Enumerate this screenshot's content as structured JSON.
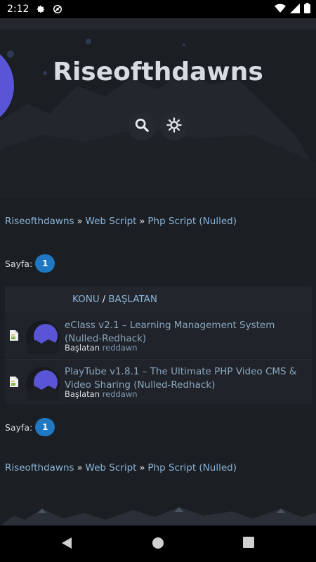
{
  "status_bar": {
    "time": "2:12"
  },
  "header": {
    "site_title": "Riseofthdawns"
  },
  "breadcrumb": {
    "items": [
      "Riseofthdawns",
      "Web Script",
      "Php Script (Nulled)"
    ],
    "separator": "»"
  },
  "pagination": {
    "label": "Sayfa:",
    "current": "1"
  },
  "topics": {
    "columns": {
      "topic": "KONU",
      "separator": "/",
      "starter": "BAŞLATAN"
    },
    "items": [
      {
        "title": "eClass v2.1 – Learning Management System (Nulled-Redhack)",
        "started_by_label": "Başlatan",
        "user": "reddawn"
      },
      {
        "title": "PlayTube v1.8.1 – The Ultimate PHP Video CMS & Video Sharing (Nulled-Redhack)",
        "started_by_label": "Başlatan",
        "user": "reddawn"
      }
    ]
  },
  "colors": {
    "accent": "#1f78c1",
    "link": "#8bb3d6",
    "background": "#1b1e23"
  }
}
